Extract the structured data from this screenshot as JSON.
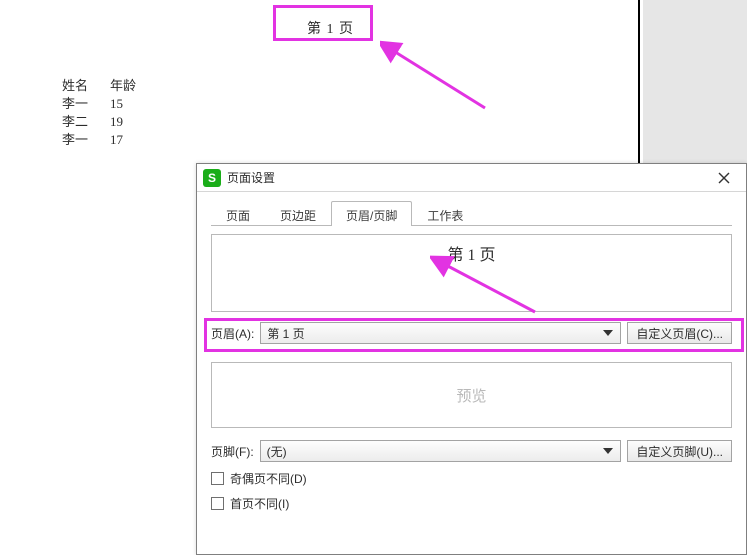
{
  "page": {
    "header_text": "第 1 页",
    "table": {
      "headers": [
        "姓名",
        "年龄"
      ],
      "rows": [
        [
          "李一",
          "15"
        ],
        [
          "李二",
          "19"
        ],
        [
          "李一",
          "17"
        ]
      ]
    }
  },
  "dialog": {
    "title": "页面设置",
    "tabs": [
      "页面",
      "页边距",
      "页眉/页脚",
      "工作表"
    ],
    "active_tab_index": 2,
    "header_preview_text": "第 1 页",
    "header_label": "页眉(A):",
    "header_combo_value": "第 1 页",
    "custom_header_btn": "自定义页眉(C)...",
    "mid_preview_label": "预览",
    "footer_label": "页脚(F):",
    "footer_combo_value": "(无)",
    "custom_footer_btn": "自定义页脚(U)...",
    "check_odd_even": "奇偶页不同(D)",
    "check_first_page": "首页不同(I)"
  },
  "annotations": {
    "color": "#E233E2"
  }
}
